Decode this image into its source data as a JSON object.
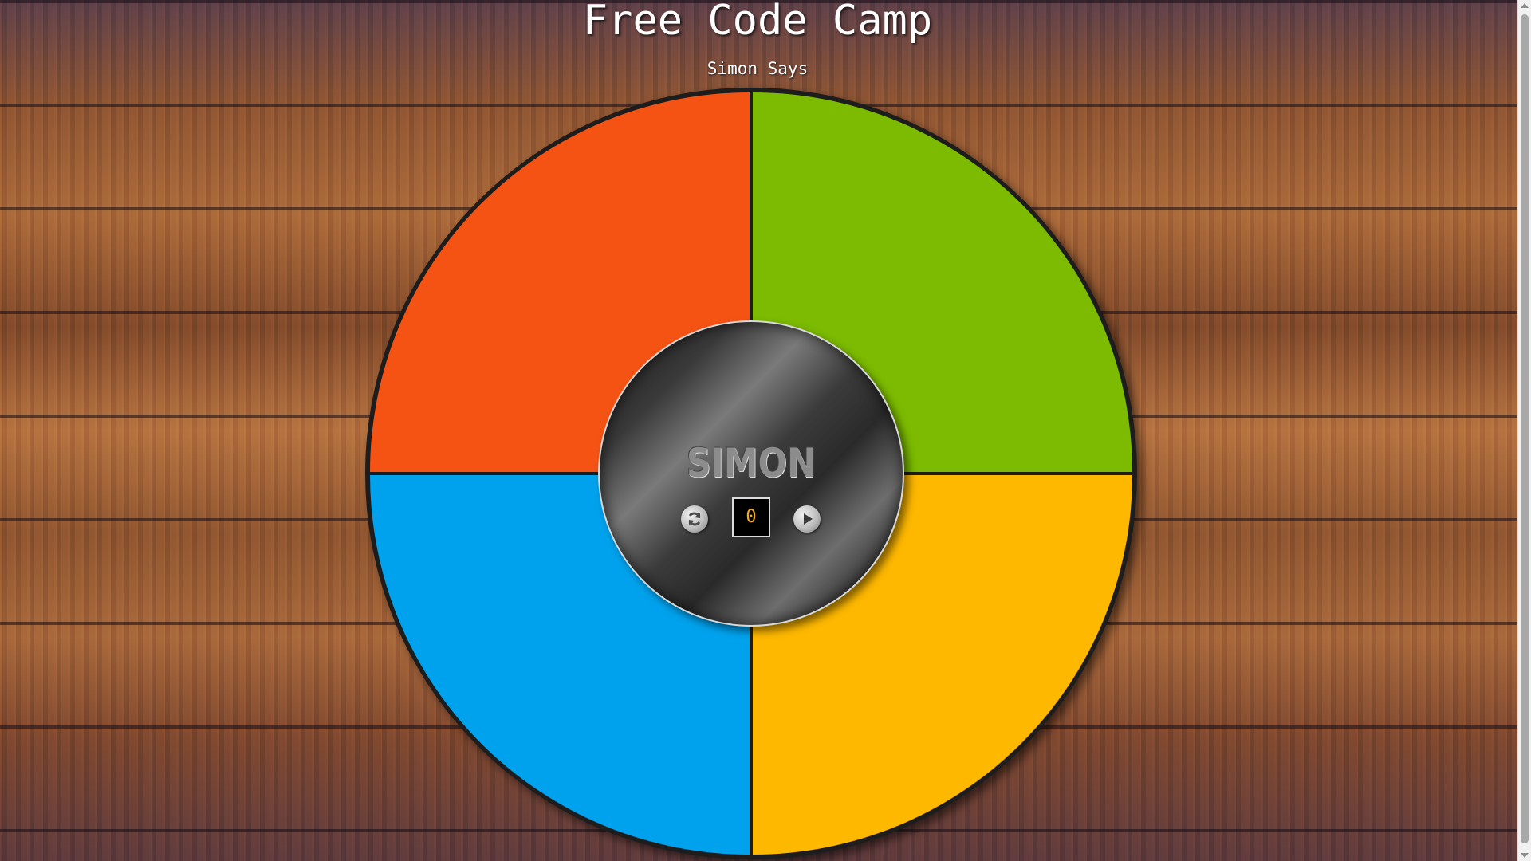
{
  "header": {
    "title": "Free Code Camp",
    "subtitle": "Simon Says"
  },
  "game": {
    "brand": "SIMON",
    "count": "0",
    "quadrants": [
      {
        "name": "red",
        "color": "#f55314"
      },
      {
        "name": "green",
        "color": "#7cbb01"
      },
      {
        "name": "blue",
        "color": "#00a2ed"
      },
      {
        "name": "yellow",
        "color": "#feb800"
      }
    ],
    "controls": {
      "restart_icon": "refresh-icon",
      "play_icon": "play-icon"
    }
  }
}
